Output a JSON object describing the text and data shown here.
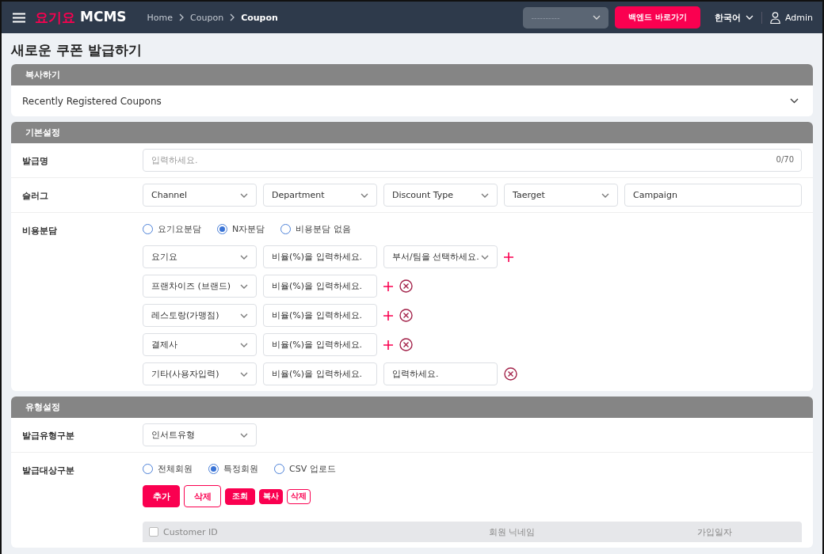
{
  "header": {
    "logo": {
      "brand": "요기요",
      "product": "MCMS"
    },
    "breadcrumbs": [
      {
        "label": "Home",
        "current": false
      },
      {
        "label": "Coupon",
        "current": false
      },
      {
        "label": "Coupon",
        "current": true
      }
    ],
    "store_select": {
      "placeholder": "----------"
    },
    "backend_button": "백엔드 바로가기",
    "language": "한국어",
    "user": "Admin"
  },
  "page_title": "새로운 쿠폰 발급하기",
  "copy_section": {
    "title": "복사하기",
    "dropdown": "Recently Registered Coupons"
  },
  "basic_section": {
    "title": "기본설정",
    "rows": [
      {
        "kind": "text",
        "label": "발급명",
        "placeholder": "입력하세요.",
        "counter": "0/70"
      },
      {
        "kind": "fields",
        "label": "슬러그",
        "fields": [
          {
            "kind": "select",
            "text": "Channel"
          },
          {
            "kind": "select",
            "text": "Department"
          },
          {
            "kind": "select",
            "text": "Discount Type"
          },
          {
            "kind": "select",
            "text": "Taerget"
          },
          {
            "kind": "input",
            "placeholder": "Campaign"
          }
        ]
      },
      {
        "kind": "cost",
        "label": "비용분담",
        "radios": [
          {
            "label": "요기요분담",
            "selected": false
          },
          {
            "label": "N자분담",
            "selected": true
          },
          {
            "label": "비용분담 없음",
            "selected": false
          }
        ],
        "shares": [
          {
            "party": "요기요",
            "ratio_placeholder": "비율(%)을 입력하세요.",
            "extra": {
              "kind": "select",
              "text": "부서/팀을 선택하세요."
            },
            "add": true,
            "remove": false
          },
          {
            "party": "프랜차이즈 (브랜드)",
            "ratio_placeholder": "비율(%)을 입력하세요.",
            "add": true,
            "remove": true
          },
          {
            "party": "레스토랑(가맹점)",
            "ratio_placeholder": "비율(%)을 입력하세요.",
            "add": true,
            "remove": true
          },
          {
            "party": "결제사",
            "ratio_placeholder": "비율(%)을 입력하세요.",
            "add": true,
            "remove": true
          },
          {
            "party": "기타(사용자입력)",
            "ratio_placeholder": "비율(%)을 입력하세요.",
            "extra": {
              "kind": "input",
              "placeholder": "입력하세요."
            },
            "add": false,
            "remove": true
          }
        ]
      }
    ]
  },
  "type_section": {
    "title": "유형설정",
    "rows": [
      {
        "kind": "select",
        "label": "발급유형구분",
        "value": "인서트유형"
      },
      {
        "kind": "target",
        "label": "발급대상구분",
        "radios": [
          {
            "label": "전체회원",
            "selected": false
          },
          {
            "label": "특정회원",
            "selected": true
          },
          {
            "label": "CSV 업로드",
            "selected": false
          }
        ],
        "buttons": [
          "추가",
          "삭제",
          "조회",
          "복사",
          "삭제"
        ],
        "table": {
          "select_all_checked": false,
          "columns": [
            "Customer ID",
            "회원 닉네임",
            "가입일자"
          ]
        }
      }
    ]
  }
}
